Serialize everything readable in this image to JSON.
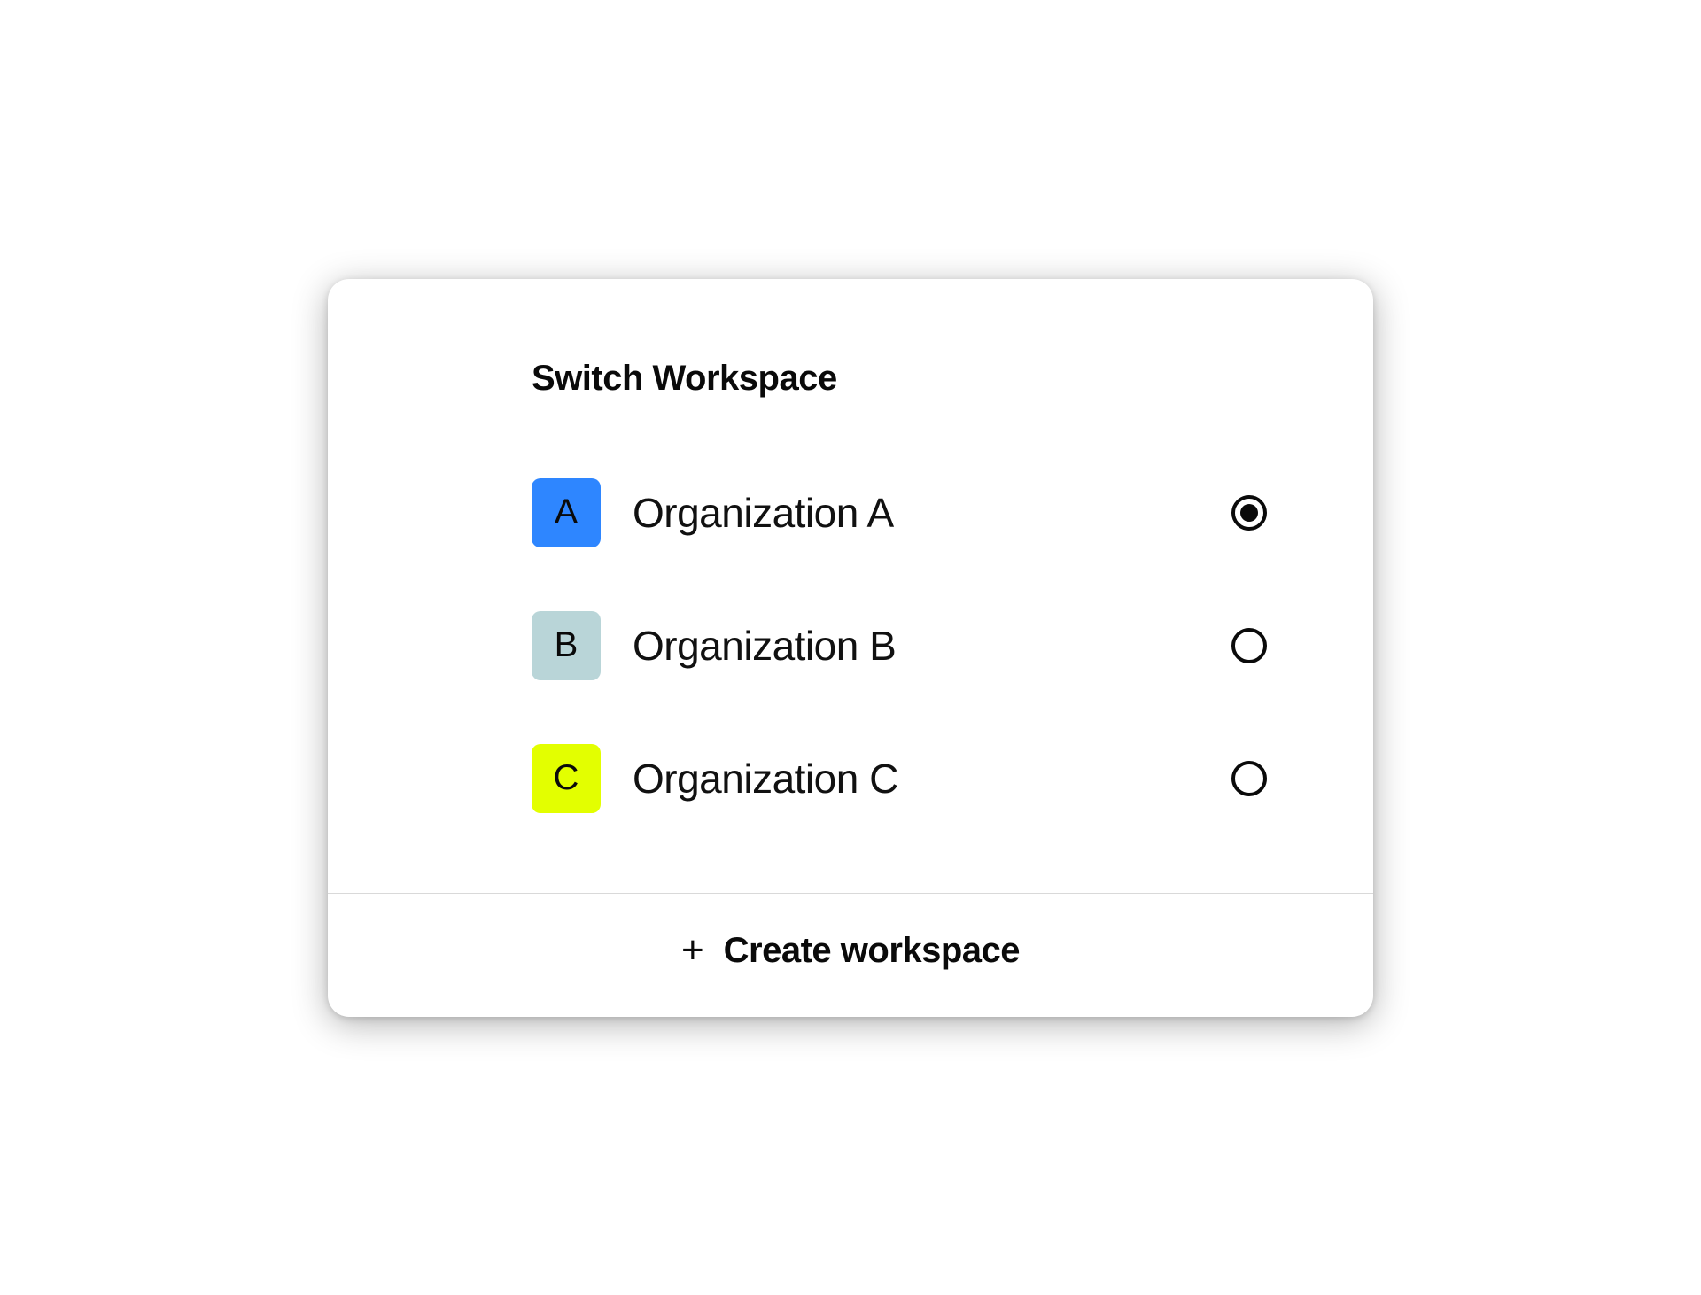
{
  "title": "Switch Workspace",
  "workspaces": [
    {
      "letter": "A",
      "name": "Organization A",
      "avatar_bg": "#2e86ff",
      "avatar_fg": "#0a0a0a",
      "selected": true
    },
    {
      "letter": "B",
      "name": "Organization B",
      "avatar_bg": "#b9d5d8",
      "avatar_fg": "#0a0a0a",
      "selected": false
    },
    {
      "letter": "C",
      "name": "Organization C",
      "avatar_bg": "#e3ff00",
      "avatar_fg": "#0a0a0a",
      "selected": false
    }
  ],
  "create_label": "Create workspace"
}
